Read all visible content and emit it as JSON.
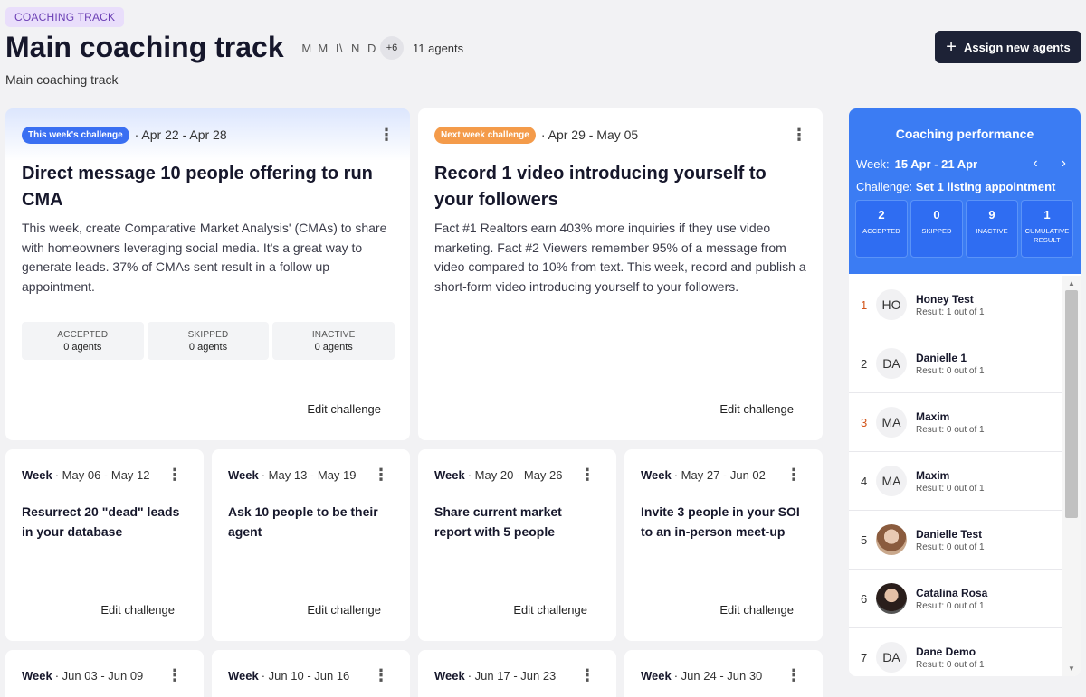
{
  "header": {
    "tag": "COACHING TRACK",
    "title": "Main coaching track",
    "subtitle": "Main coaching track",
    "avatar_initials": [
      "M",
      "M",
      "I\\",
      "N",
      "D"
    ],
    "avatar_more": "+6",
    "agents_count": "11 agents",
    "assign_button": "Assign new agents",
    "assign_icon": "plus-icon"
  },
  "current_challenge": {
    "badge": "This week's challenge",
    "dates": "· Apr 22 - Apr 28",
    "title": "Direct message 10 people offering to run CMA",
    "description": "This week, create Comparative Market Analysis' (CMAs) to share with homeowners leveraging social media. It's a great way to generate leads. 37% of CMAs sent result in a follow up appointment.",
    "stats": [
      {
        "label": "ACCEPTED",
        "value": "0 agents"
      },
      {
        "label": "SKIPPED",
        "value": "0 agents"
      },
      {
        "label": "INACTIVE",
        "value": "0 agents"
      }
    ],
    "edit": "Edit challenge"
  },
  "next_challenge": {
    "badge": "Next week challenge",
    "dates": "· Apr 29 - May 05",
    "title": "Record 1 video introducing yourself to your followers",
    "description": "Fact #1 Realtors earn 403% more inquiries if they use video marketing. Fact #2 Viewers remember 95% of a message from video compared to 10% from text. This week, record and publish a short-form video introducing yourself to your followers.",
    "edit": "Edit challenge"
  },
  "weeks_row2": [
    {
      "week": "Week",
      "dates": "· May 06 - May 12",
      "title": "Resurrect 20 \"dead\" leads in your database",
      "edit": "Edit challenge"
    },
    {
      "week": "Week",
      "dates": "· May 13 - May 19",
      "title": "Ask 10 people to be their agent",
      "edit": "Edit challenge"
    },
    {
      "week": "Week",
      "dates": "· May 20 - May 26",
      "title": "Share current market report with 5 people",
      "edit": "Edit challenge"
    },
    {
      "week": "Week",
      "dates": "· May 27 - Jun 02",
      "title": "Invite 3 people in your SOI to an in-person meet-up",
      "edit": "Edit challenge"
    }
  ],
  "weeks_row3": [
    {
      "week": "Week",
      "dates": "· Jun 03 - Jun 09"
    },
    {
      "week": "Week",
      "dates": "· Jun 10 - Jun 16"
    },
    {
      "week": "Week",
      "dates": "· Jun 17 - Jun 23"
    },
    {
      "week": "Week",
      "dates": "· Jun 24 - Jun 30"
    }
  ],
  "performance": {
    "title": "Coaching performance",
    "week_label": "Week:",
    "week_value": "15 Apr - 21 Apr",
    "challenge_label": "Challenge:",
    "challenge_value": "Set 1 listing appointment",
    "stats": [
      {
        "value": "2",
        "label": "ACCEPTED"
      },
      {
        "value": "0",
        "label": "SKIPPED"
      },
      {
        "value": "9",
        "label": "INACTIVE"
      },
      {
        "value": "1",
        "label": "CUMULATIVE RESULT"
      }
    ],
    "leaderboard": [
      {
        "rank": "1",
        "initials": "HO",
        "name": "Honey Test",
        "result": "Result: 1 out of 1"
      },
      {
        "rank": "2",
        "initials": "DA",
        "name": "Danielle 1",
        "result": "Result: 0 out of 1"
      },
      {
        "rank": "3",
        "initials": "MA",
        "name": "Maxim",
        "result": "Result: 0 out of 1"
      },
      {
        "rank": "4",
        "initials": "MA",
        "name": "Maxim",
        "result": "Result: 0 out of 1"
      },
      {
        "rank": "5",
        "initials": "",
        "name": "Danielle Test",
        "result": "Result: 0 out of 1"
      },
      {
        "rank": "6",
        "initials": "",
        "name": "Catalina Rosa",
        "result": "Result: 0 out of 1"
      },
      {
        "rank": "7",
        "initials": "DA",
        "name": "Dane Demo",
        "result": "Result: 0 out of 1"
      }
    ]
  },
  "colors": {
    "accent_blue": "#3b7cf3",
    "badge_orange": "#f49b4a",
    "dark_button": "#1d2236",
    "rank_highlight": "#d2541a"
  }
}
